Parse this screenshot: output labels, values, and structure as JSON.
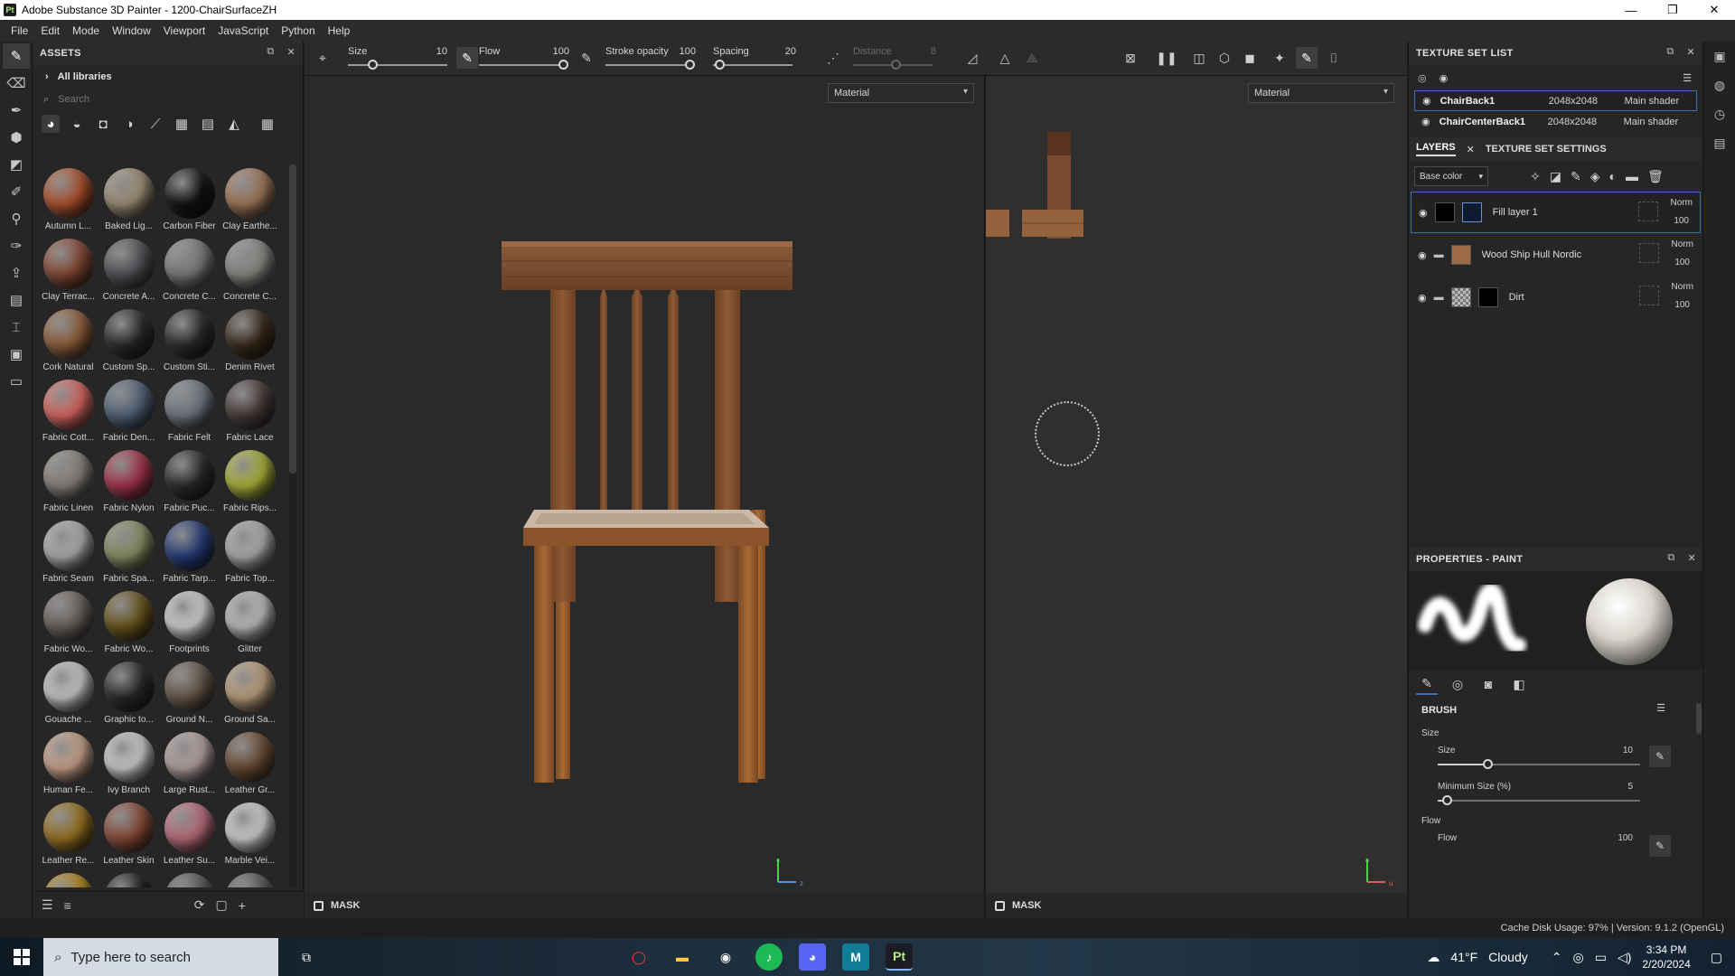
{
  "window": {
    "title": "Adobe Substance 3D Painter - 1200-ChairSurfaceZH",
    "app_icon": "Pt",
    "controls": [
      "—",
      "❐",
      "✕"
    ]
  },
  "menu": [
    "File",
    "Edit",
    "Mode",
    "Window",
    "Viewport",
    "JavaScript",
    "Python",
    "Help"
  ],
  "assets": {
    "title": "ASSETS",
    "library": "All libraries",
    "search_placeholder": "Search",
    "items": [
      {
        "label": "Autumn L...",
        "color": "#b4532d"
      },
      {
        "label": "Baked Lig...",
        "color": "#a39378"
      },
      {
        "label": "Carbon Fiber",
        "color": "#111111"
      },
      {
        "label": "Clay Earthe...",
        "color": "#a67c5c"
      },
      {
        "label": "Clay Terrac...",
        "color": "#8a4a36"
      },
      {
        "label": "Concrete A...",
        "color": "#55555a"
      },
      {
        "label": "Concrete C...",
        "color": "#808080"
      },
      {
        "label": "Concrete C...",
        "color": "#8c8c88"
      },
      {
        "label": "Cork Natural",
        "color": "#94603c"
      },
      {
        "label": "Custom Sp...",
        "color": "#2a2a2a"
      },
      {
        "label": "Custom Sti...",
        "color": "#2a2a2a"
      },
      {
        "label": "Denim Rivet",
        "color": "#3b2b1c"
      },
      {
        "label": "Fabric Cott...",
        "color": "#e06a64"
      },
      {
        "label": "Fabric Den...",
        "color": "#54667e"
      },
      {
        "label": "Fabric Felt",
        "color": "#737c86"
      },
      {
        "label": "Fabric Lace",
        "color": "#4a3c3c"
      },
      {
        "label": "Fabric Linen",
        "color": "#8c8680"
      },
      {
        "label": "Fabric Nylon",
        "color": "#a8334a"
      },
      {
        "label": "Fabric Puc...",
        "color": "#2b2b2b"
      },
      {
        "label": "Fabric Rips...",
        "color": "#b0b838"
      },
      {
        "label": "Fabric Seam",
        "color": "#b4b4b4"
      },
      {
        "label": "Fabric Spa...",
        "color": "#8c9468"
      },
      {
        "label": "Fabric Tarp...",
        "color": "#253c7c"
      },
      {
        "label": "Fabric Top...",
        "color": "#b4b4b4"
      },
      {
        "label": "Fabric Wo...",
        "color": "#6c6460"
      },
      {
        "label": "Fabric Wo...",
        "color": "#6c561c"
      },
      {
        "label": "Footprints",
        "color": "#d8d8d8"
      },
      {
        "label": "Glitter",
        "color": "#c4c4c4"
      },
      {
        "label": "Gouache ...",
        "color": "#cfcfcf"
      },
      {
        "label": "Graphic to...",
        "color": "#2a2a2a"
      },
      {
        "label": "Ground N...",
        "color": "#6a5a4c"
      },
      {
        "label": "Ground Sa...",
        "color": "#c4a582"
      },
      {
        "label": "Human Fe...",
        "color": "#d2a890"
      },
      {
        "label": "Ivy Branch",
        "color": "#d4d4d4"
      },
      {
        "label": "Large Rust...",
        "color": "#bca8a8"
      },
      {
        "label": "Leather Gr...",
        "color": "#6c4c34"
      },
      {
        "label": "Leather Re...",
        "color": "#9c7420"
      },
      {
        "label": "Leather Skin",
        "color": "#8c4c38"
      },
      {
        "label": "Leather Su...",
        "color": "#c07080"
      },
      {
        "label": "Marble Vei...",
        "color": "#d8d8d8"
      },
      {
        "label": "",
        "color": "#b88a1c"
      },
      {
        "label": "",
        "color": "#1c1c1c"
      },
      {
        "label": "",
        "color": "#5c5c5c"
      },
      {
        "label": "",
        "color": "#5c5c5c"
      }
    ]
  },
  "toolbar": {
    "size_label": "Size",
    "size_value": "10",
    "flow_label": "Flow",
    "flow_value": "100",
    "stroke_label": "Stroke opacity",
    "stroke_value": "100",
    "spacing_label": "Spacing",
    "spacing_value": "20",
    "distance_label": "Distance",
    "distance_value": "8"
  },
  "viewport3d": {
    "dropdown": "Material",
    "mask_label": "MASK"
  },
  "viewport2d": {
    "dropdown": "Material",
    "mask_label": "MASK"
  },
  "texture_sets": {
    "title": "TEXTURE SET LIST",
    "rows": [
      {
        "name": "ChairBack1",
        "res": "2048x2048",
        "shader": "Main shader"
      },
      {
        "name": "ChairCenterBack1",
        "res": "2048x2048",
        "shader": "Main shader"
      }
    ]
  },
  "layers_panel": {
    "tab_layers": "LAYERS",
    "tab_settings": "TEXTURE SET SETTINGS",
    "channel": "Base color",
    "layers": [
      {
        "name": "Fill layer 1",
        "blend": "Norm",
        "opacity": "100"
      },
      {
        "name": "Wood Ship Hull Nordic",
        "blend": "Norm",
        "opacity": "100"
      },
      {
        "name": "Dirt",
        "blend": "Norm",
        "opacity": "100"
      }
    ]
  },
  "properties": {
    "title": "PROPERTIES - PAINT",
    "brush_section": "BRUSH",
    "size_group": "Size",
    "size_label": "Size",
    "size_value": "10",
    "size_fraction": 0.25,
    "min_size_label": "Minimum Size (%)",
    "min_size_value": "5",
    "min_size_fraction": 0.05,
    "flow_group": "Flow",
    "flow_label": "Flow",
    "flow_value": "100"
  },
  "status": {
    "text": "Cache Disk Usage:   97%  |  Version: 9.1.2 (OpenGL)"
  },
  "taskbar": {
    "search_placeholder": "Type here to search",
    "weather_temp": "41°F",
    "weather_desc": "Cloudy",
    "time": "3:34 PM",
    "date": "2/20/2024"
  }
}
